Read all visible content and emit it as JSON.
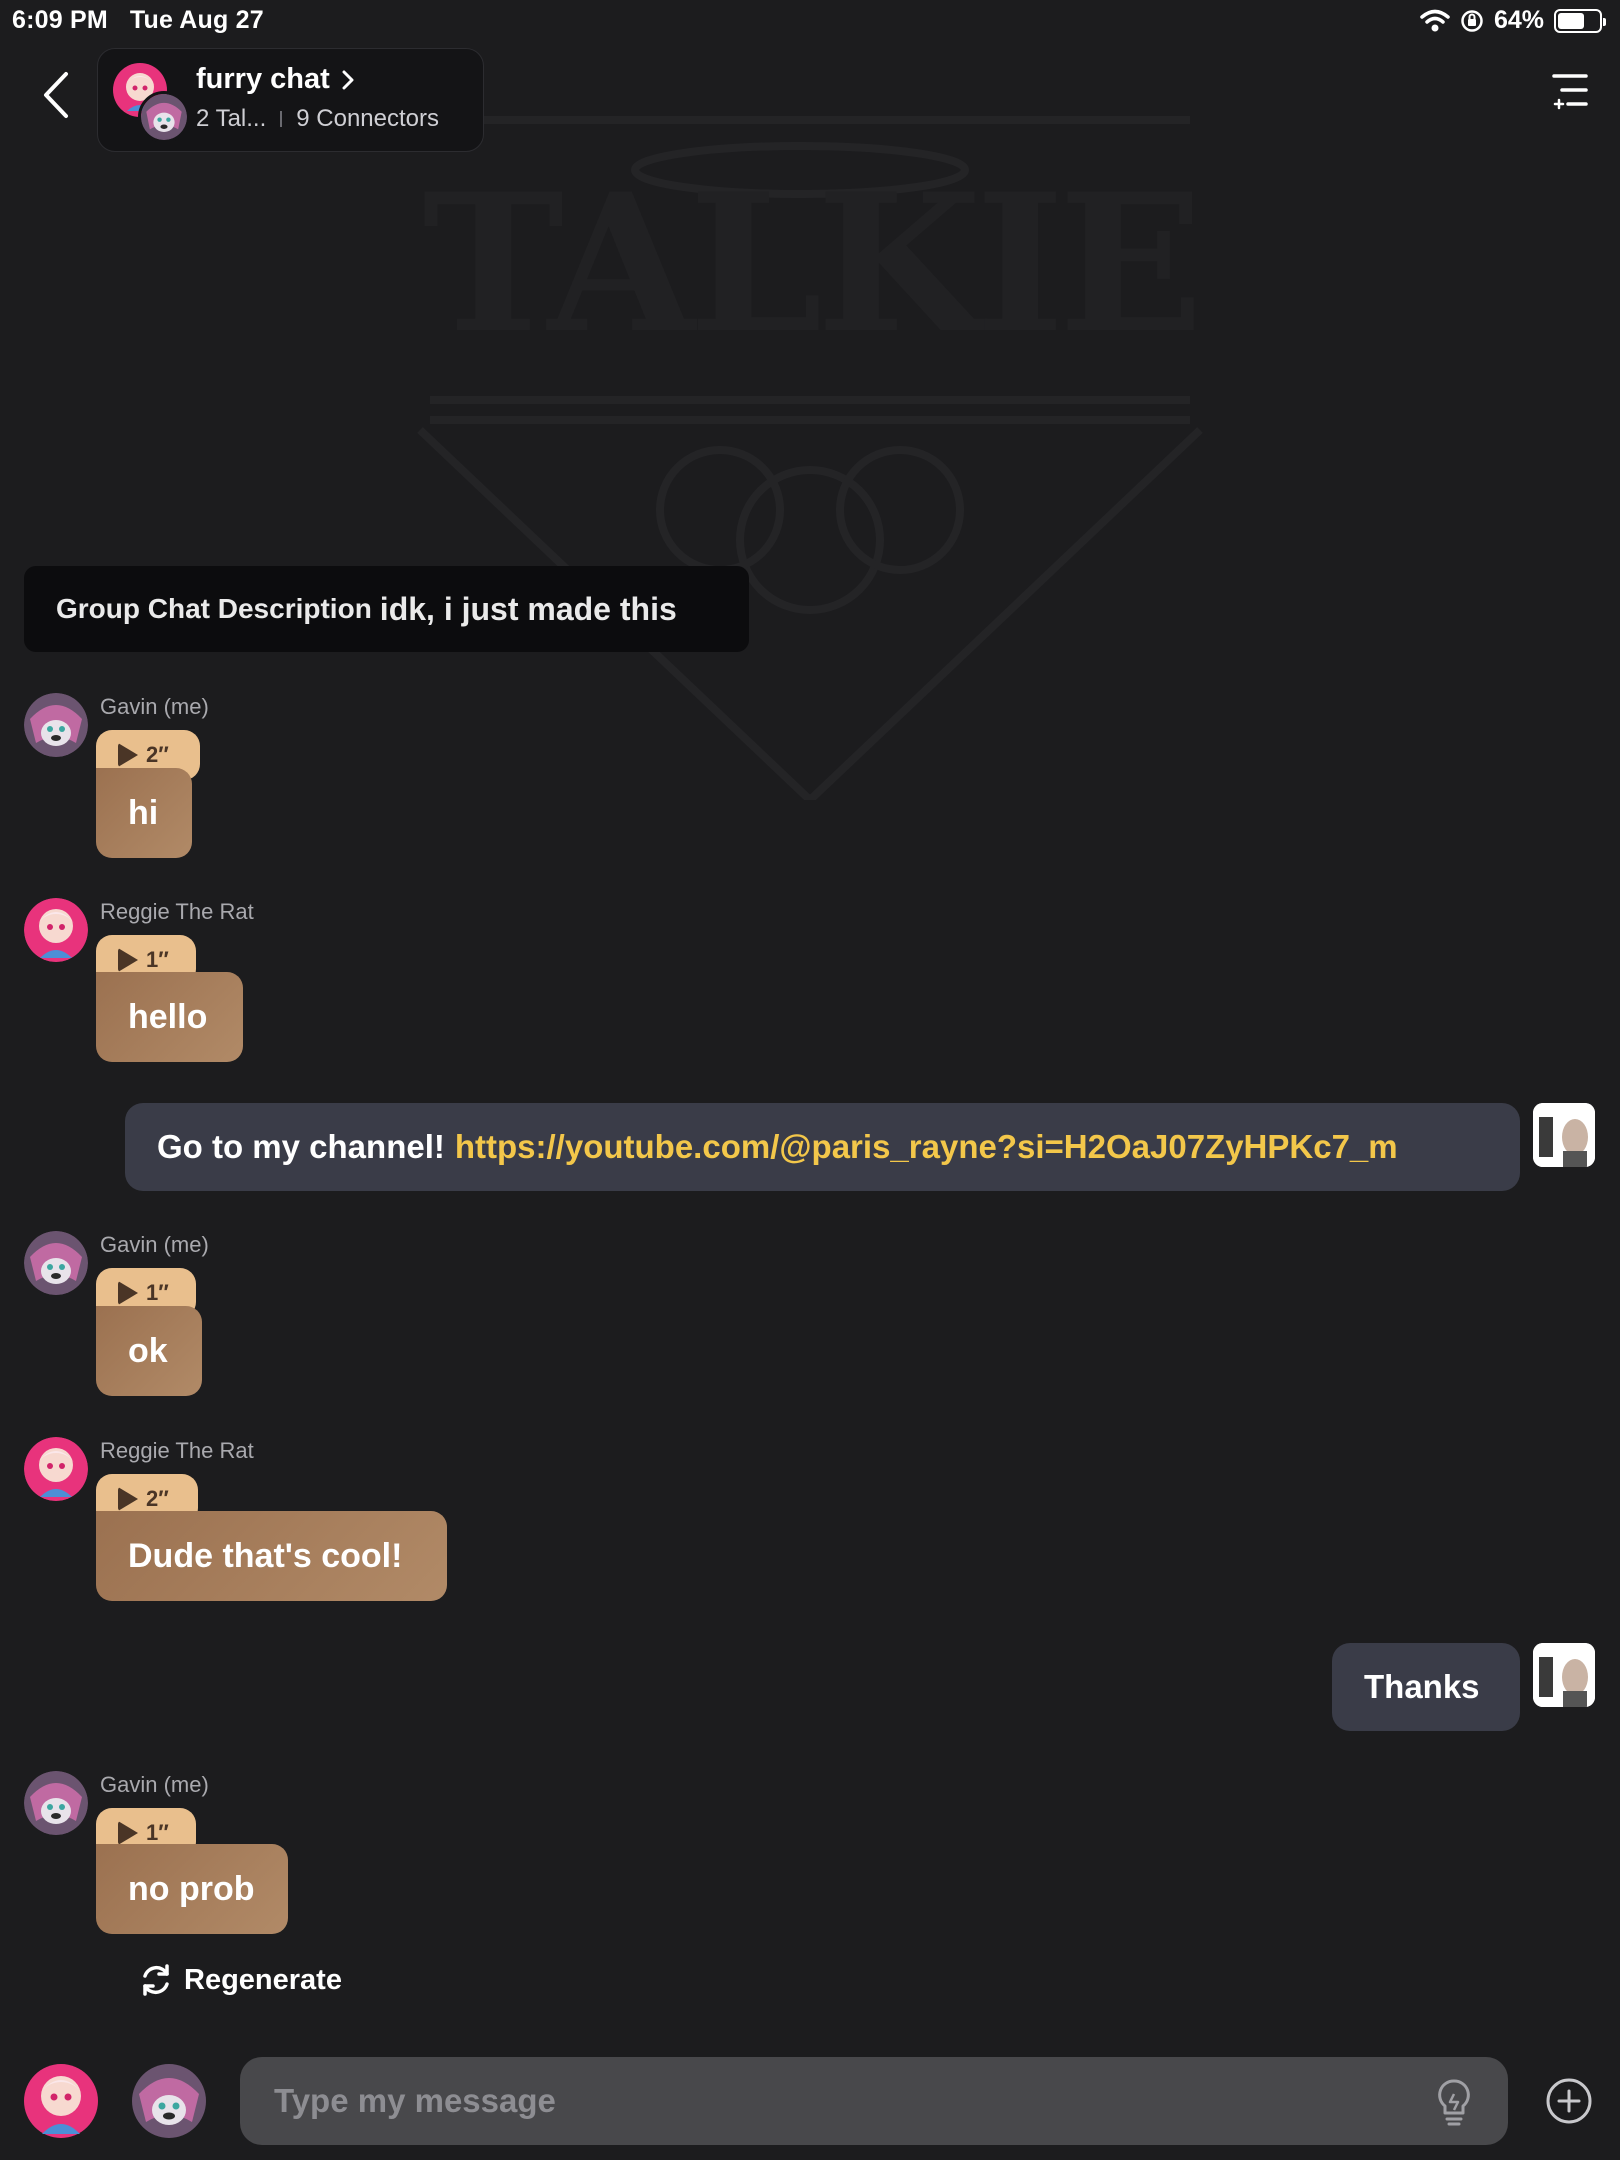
{
  "status_bar": {
    "time": "6:09 PM",
    "date": "Tue Aug 27",
    "battery": "64%"
  },
  "header": {
    "title": "furry chat",
    "talkies": "2 Tal...",
    "connectors": "9 Connectors"
  },
  "description": {
    "label": "Group Chat Description",
    "value": "idk, i just made this"
  },
  "messages": [
    {
      "sender": "Gavin (me)",
      "duration": "2″",
      "text": "hi"
    },
    {
      "sender": "Reggie The Rat",
      "duration": "1″",
      "text": "hello"
    },
    {
      "text": "Go to my channel!",
      "link": "https://youtube.com/@paris_rayne?si=H2OaJ07ZyHPKc7_m"
    },
    {
      "sender": "Gavin (me)",
      "duration": "1″",
      "text": "ok"
    },
    {
      "sender": "Reggie The Rat",
      "duration": "2″",
      "text": "Dude that's cool!"
    },
    {
      "text": "Thanks"
    },
    {
      "sender": "Gavin (me)",
      "duration": "1″",
      "text": "no prob"
    }
  ],
  "regenerate": "Regenerate",
  "composer": {
    "placeholder": "Type my message"
  },
  "watermark": "TALKIE",
  "colors": {
    "ai_bubble": "#a57b59",
    "audio_pill": "#e9bf8d",
    "user_bubble": "#3a3c48",
    "link": "#f3c74a"
  }
}
